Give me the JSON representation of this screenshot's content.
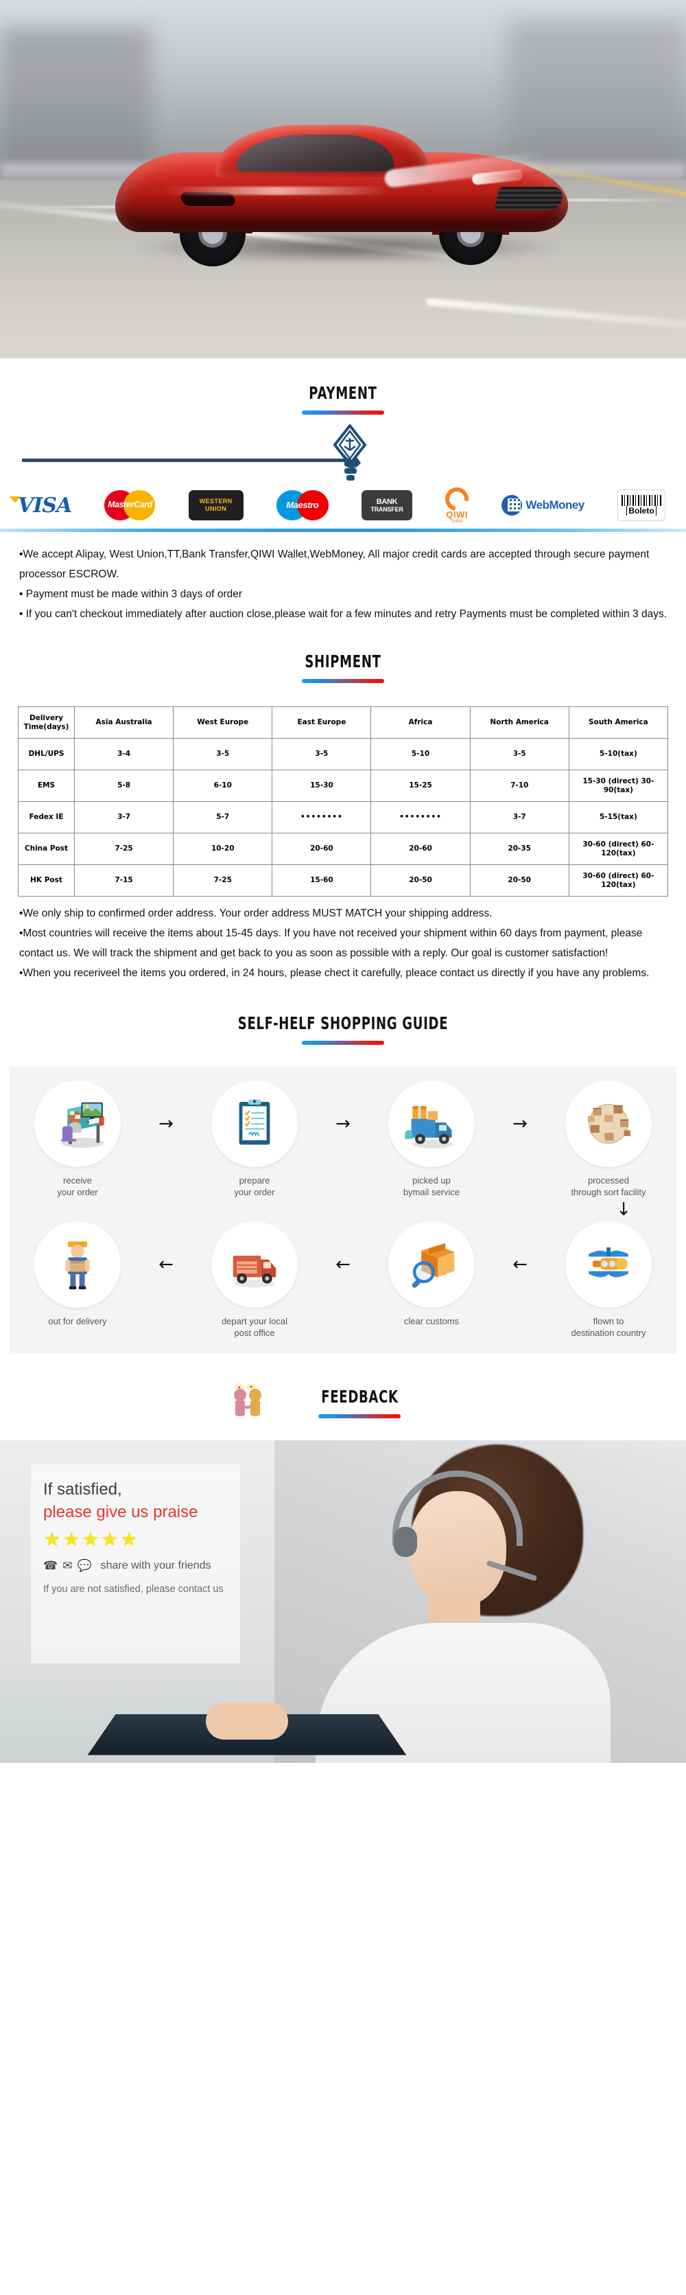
{
  "hero": {
    "alt": "red sports car driving on highway"
  },
  "payment": {
    "title": "PAYMENT",
    "badge_icon": "payment-hand-badge-icon",
    "logos": [
      {
        "name": "visa-logo",
        "label": "VISA"
      },
      {
        "name": "mastercard-logo",
        "label": "MasterCard"
      },
      {
        "name": "western-union-logo",
        "label_top": "WESTERN",
        "label_bottom": "UNION"
      },
      {
        "name": "maestro-logo",
        "label": "Maestro"
      },
      {
        "name": "bank-transfer-logo",
        "label_top": "BANK",
        "label_bottom": "TRANSFER"
      },
      {
        "name": "qiwi-logo",
        "label": "QIWI",
        "sub": "КИВИ"
      },
      {
        "name": "webmoney-logo",
        "label": "WebMoney"
      },
      {
        "name": "boleto-logo",
        "label": "Boleto"
      }
    ],
    "lines": [
      "•We accept Alipay, West Union,TT,Bank Transfer,QIWI Wallet,WebMoney, All major credit cards are accepted through secure payment processor ESCROW.",
      "• Payment must be made within 3 days of order",
      "• If you can't checkout immediately after auction close,please wait for a few minutes and retry Payments must be completed within 3 days."
    ]
  },
  "shipment": {
    "title": "SHIPMENT",
    "table": {
      "headers": [
        "Delivery Time(days)",
        "Asia Australia",
        "West Europe",
        "East Europe",
        "Africa",
        "North America",
        "South America"
      ],
      "rows": [
        {
          "method": "DHL/UPS",
          "cells": [
            "3-4",
            "3-5",
            "3-5",
            "5-10",
            "3-5",
            "5-10(tax)"
          ]
        },
        {
          "method": "EMS",
          "cells": [
            "5-8",
            "6-10",
            "15-30",
            "15-25",
            "7-10",
            "15-30 (direct) 30-90(tax)"
          ]
        },
        {
          "method": "Fedex IE",
          "cells": [
            "3-7",
            "5-7",
            "••••••••",
            "••••••••",
            "3-7",
            "5-15(tax)"
          ]
        },
        {
          "method": "China Post",
          "cells": [
            "7-25",
            "10-20",
            "20-60",
            "20-60",
            "20-35",
            "30-60 (direct) 60-120(tax)"
          ]
        },
        {
          "method": "HK Post",
          "cells": [
            "7-15",
            "7-25",
            "15-60",
            "20-50",
            "20-50",
            "30-60 (direct) 60-120(tax)"
          ]
        }
      ]
    },
    "lines": [
      "•We only ship to confirmed order address. Your order address MUST MATCH your shipping address.",
      "•Most countries will receive the items about 15-45 days. If you have not received your shipment within 60 days from payment, please contact us. We will track the shipment and get back to you as soon as possible with a reply. Our goal is customer satisfaction!",
      "•When you receriveel the items you ordered, in 24 hours, please chect it carefully, pleace contact us directly if you have any problems."
    ]
  },
  "guide": {
    "title": "SELF-HELF SHOPPING GUIDE",
    "row1": [
      {
        "icon": "desk-computer-icon",
        "label": "receive\nyour order"
      },
      {
        "icon": "clipboard-checklist-icon",
        "label": "prepare\nyour order"
      },
      {
        "icon": "delivery-truck-icon",
        "label": "picked up\nbymail service"
      },
      {
        "icon": "sorting-facility-icon",
        "label": "processed\nthrough sort facility"
      }
    ],
    "row2": [
      {
        "icon": "delivery-man-icon",
        "label": "out for delivery"
      },
      {
        "icon": "mail-truck-icon",
        "label": "depart your local\npost office"
      },
      {
        "icon": "customs-inspect-icon",
        "label": "clear customs"
      },
      {
        "icon": "airplane-icon",
        "label": "flown to\ndestination country"
      }
    ],
    "arrow_right": "→",
    "arrow_left": "←",
    "arrow_down": "↓"
  },
  "feedback": {
    "title": "FEEDBACK",
    "people_icon": "two-people-handshake-icon",
    "panel": {
      "line1": "If satisfied,",
      "line2": "please give us praise",
      "stars": 5,
      "star_glyph": "★",
      "share_icons": [
        "phone-icon",
        "envelope-icon",
        "chat-bubble-icon"
      ],
      "share_text": "share with your friends",
      "footer": "If you are not satisfied, please contact us"
    }
  },
  "colors": {
    "accent_blue": "#1e9cf0",
    "accent_red": "#f20d0b",
    "panel_gray": "#f4f4f4",
    "rule_navy": "#2c4a66"
  }
}
